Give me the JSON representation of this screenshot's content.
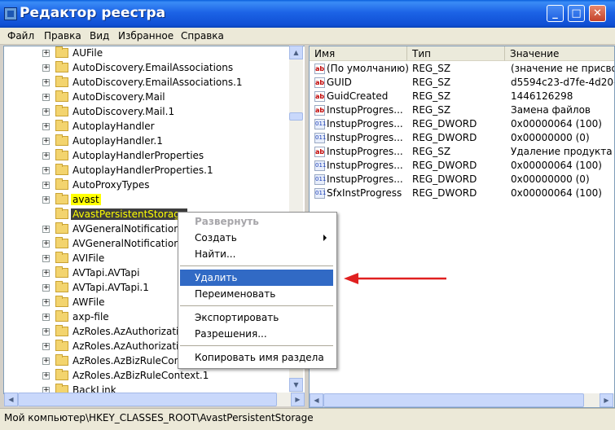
{
  "window": {
    "title": "Редактор реестра"
  },
  "menu": [
    "Файл",
    "Правка",
    "Вид",
    "Избранное",
    "Справка"
  ],
  "tree_items": [
    {
      "label": "AUFile"
    },
    {
      "label": "AutoDiscovery.EmailAssociations"
    },
    {
      "label": "AutoDiscovery.EmailAssociations.1"
    },
    {
      "label": "AutoDiscovery.Mail"
    },
    {
      "label": "AutoDiscovery.Mail.1"
    },
    {
      "label": "AutoplayHandler"
    },
    {
      "label": "AutoplayHandler.1"
    },
    {
      "label": "AutoplayHandlerProperties"
    },
    {
      "label": "AutoplayHandlerProperties.1"
    },
    {
      "label": "AutoProxyTypes"
    },
    {
      "label": "avast"
    },
    {
      "label": "AvastPersistentStorage"
    },
    {
      "label": "AVGeneralNotification.A"
    },
    {
      "label": "AVGeneralNotification.A"
    },
    {
      "label": "AVIFile"
    },
    {
      "label": "AVTapi.AVTapi"
    },
    {
      "label": "AVTapi.AVTapi.1"
    },
    {
      "label": "AWFile"
    },
    {
      "label": "axp-file"
    },
    {
      "label": "AzRoles.AzAuthorization"
    },
    {
      "label": "AzRoles.AzAuthorization"
    },
    {
      "label": "AzRoles.AzBizRuleContext"
    },
    {
      "label": "AzRoles.AzBizRuleContext.1"
    },
    {
      "label": "BackLink"
    }
  ],
  "columns": [
    "Имя",
    "Тип",
    "Значение"
  ],
  "values": [
    {
      "icon": "string-value-icon",
      "name": "(По умолчанию)",
      "type": "REG_SZ",
      "data": "(значение не присво"
    },
    {
      "icon": "string-value-icon",
      "name": "GUID",
      "type": "REG_SZ",
      "data": "d5594c23-d7fe-4d20-"
    },
    {
      "icon": "string-value-icon",
      "name": "GuidCreated",
      "type": "REG_SZ",
      "data": "1446126298"
    },
    {
      "icon": "string-value-icon",
      "name": "InstupProgres...",
      "type": "REG_SZ",
      "data": "Замена файлов"
    },
    {
      "icon": "binary-value-icon",
      "name": "InstupProgres...",
      "type": "REG_DWORD",
      "data": "0x00000064 (100)"
    },
    {
      "icon": "binary-value-icon",
      "name": "InstupProgres...",
      "type": "REG_DWORD",
      "data": "0x00000000 (0)"
    },
    {
      "icon": "string-value-icon",
      "name": "InstupProgres...",
      "type": "REG_SZ",
      "data": "Удаление продукта"
    },
    {
      "icon": "binary-value-icon",
      "name": "InstupProgres...",
      "type": "REG_DWORD",
      "data": "0x00000064 (100)"
    },
    {
      "icon": "binary-value-icon",
      "name": "InstupProgres...",
      "type": "REG_DWORD",
      "data": "0x00000000 (0)"
    },
    {
      "icon": "binary-value-icon",
      "name": "SfxInstProgress",
      "type": "REG_DWORD",
      "data": "0x00000064 (100)"
    }
  ],
  "context_menu": {
    "expand": "Развернуть",
    "create": "Создать",
    "find": "Найти...",
    "delete": "Удалить",
    "rename": "Переименовать",
    "export": "Экспортировать",
    "permissions": "Разрешения...",
    "copy_key_name": "Копировать имя раздела"
  },
  "status": {
    "path": "Мой компьютер\\HKEY_CLASSES_ROOT\\AvastPersistentStorage"
  },
  "colors": {
    "titlebar": "#0f4fd4",
    "selection": "#316ac5",
    "highlight": "#ffff00",
    "arrow": "#e02020"
  }
}
